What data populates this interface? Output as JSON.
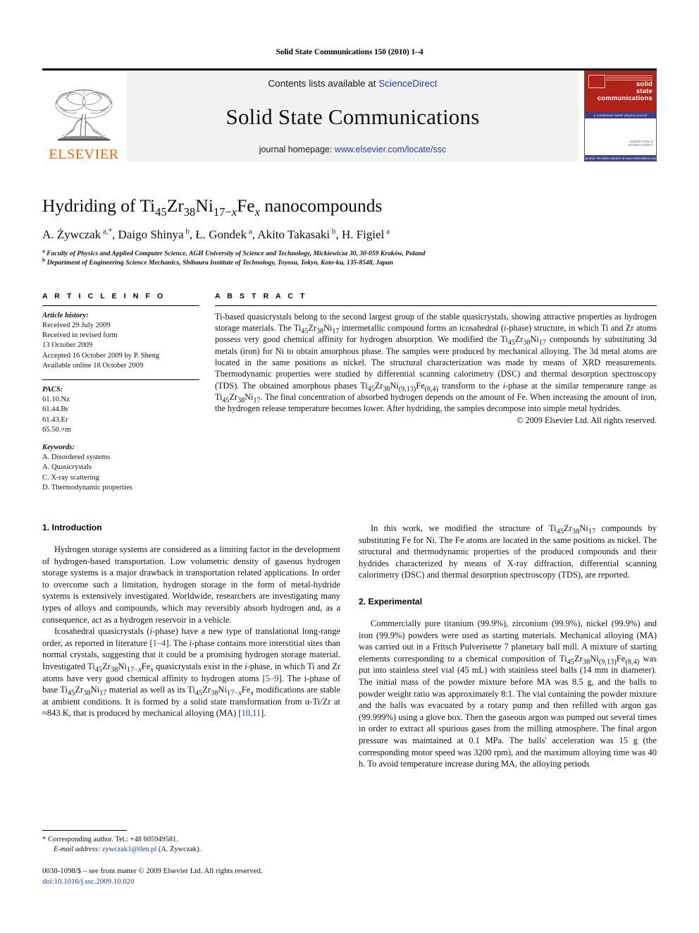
{
  "running_head": "Solid State Communications 150 (2010) 1–4",
  "journal_header": {
    "publisher_logo_text": "ELSEVIER",
    "contents_prefix": "Contents lists available at ",
    "contents_link": "ScienceDirect",
    "journal_title": "Solid State Communications",
    "homepage_prefix": "journal homepage: ",
    "homepage_url": "www.elsevier.com/locate/ssc",
    "cover": {
      "line1": "solid",
      "line2": "state",
      "line3": "communications",
      "strip_text": "a condensed matter physics journal",
      "footer_note_1": "available online at",
      "footer_note_2": "SCIENCE DIRECT",
      "bottom_strip": "Journal: The latest research at www.sciencedirect.com"
    },
    "link_color": "#2b3c9e",
    "band_color": "#f2f2f2",
    "elsevier_orange": "#ec6608",
    "cover_red": "#b02318"
  },
  "article": {
    "title_parts": [
      {
        "t": "Hydriding of Ti"
      },
      {
        "t": "45",
        "k": "sub"
      },
      {
        "t": "Zr"
      },
      {
        "t": "38",
        "k": "sub"
      },
      {
        "t": "Ni"
      },
      {
        "t": "17−x",
        "k": "sub-italic-x"
      },
      {
        "t": "Fe"
      },
      {
        "t": "x",
        "k": "sub-italic"
      },
      {
        "t": " nanocompounds"
      }
    ],
    "title_plain": "Hydriding of Ti45Zr38Ni17−xFex nanocompounds",
    "authors_plain": "A. Żywczak a,*, Daigo Shinya b, Ł. Gondek a, Akito Takasaki b, H. Figiel a",
    "affiliation_a": "Faculty of Physics and Applied Computer Science, AGH University of Science and Technology, Mickiewicza 30, 30-059 Kraków, Poland",
    "affiliation_b": "Department of Engineering Science Mechanics, Shibaura Institute of Technology, Toyosu, Tokyo, Koto-ku, 135-8548, Japan",
    "affiliation_a_marker": "a",
    "affiliation_b_marker": "b"
  },
  "article_info": {
    "heading": "A R T I C L E    I N F O",
    "history_label": "Article history:",
    "history_lines": [
      "Received 29 July 2009",
      "Received in revised form",
      "13 October 2009",
      "Accepted 16 October 2009 by P. Sheng",
      "Available online 18 October 2009"
    ],
    "pacs_label": "PACS:",
    "pacs": [
      "61.10.Nz",
      "61.44.Br",
      "61.43.Er",
      "65.50.+m"
    ],
    "keywords_label": "Keywords:",
    "keywords": [
      "A. Disordered systems",
      "A. Quasicrystals",
      "C. X-ray scattering",
      "D. Thermodynamic properties"
    ]
  },
  "abstract": {
    "heading": "A B S T R A C T",
    "text": "Ti-based quasicrystals belong to the second largest group of the stable quasicrystals, showing attractive properties as hydrogen storage materials. The Ti45Zr38Ni17 intermetallic compound forms an icosahedral (i-phase) structure, in which Ti and Zr atoms possess very good chemical affinity for hydrogen absorption. We modified the Ti45Zr38Ni17 compounds by substituting 3d metals (iron) for Ni to obtain amorphous phase. The samples were produced by mechanical alloying. The 3d metal atoms are located in the same positions as nickel. The structural characterization was made by means of XRD measurements. Thermodynamic properties were studied by differential scanning calorimetry (DSC) and thermal desorption spectroscopy (TDS). The obtained amorphous phases Ti45Zr38Ni(9,13)Fe(8,4) transform to the i-phase at the similar temperature range as Ti45Zr38Ni17. The final concentration of absorbed hydrogen depends on the amount of Fe. When increasing the amount of iron, the hydrogen release temperature becomes lower. After hydriding, the samples decompose into simple metal hydrides.",
    "copyright": "© 2009 Elsevier Ltd. All rights reserved."
  },
  "sections": {
    "intro_heading": "1. Introduction",
    "intro_p1": "Hydrogen storage systems are considered as a limiting factor in the development of hydrogen-based transportation. Low volumetric density of gaseous hydrogen storage systems is a major drawback in transportation related applications. In order to overcome such a limitation, hydrogen storage in the form of metal-hydride systems is extensively investigated. Worldwide, researchers are investigating many types of alloys and compounds, which may reversibly absorb hydrogen and, as a consequence, act as a hydrogen reservoir in a vehicle.",
    "intro_p2_plain": "Icosahedral quasicrystals (i-phase) have a new type of translational long-range order, as reported in literature [1–4]. The i-phase contains more interstitial sites than normal crystals, suggesting that it could be a promising hydrogen storage material. Investigated Ti45Zr38Ni17−xFex quasicrystals exist in the i-phase, in which Ti and Zr atoms have very good chemical affinity to hydrogen atoms [5–9]. The i-phase of base Ti45Zr38Ni17 material as well as its Ti45Zr38Ni17−xFex modifications are stable at ambient conditions. It is formed by a solid state transformation from α-Ti/Zr at ≈843 K, that is produced by mechanical alloying (MA) [10,11].",
    "right_p1_plain": "In this work, we modified the structure of Ti45Zr38Ni17 compounds by substituting Fe for Ni. The Fe atoms are located in the same positions as nickel. The structural and thermodynamic properties of the produced compounds and their hydrides characterized by means of X-ray diffraction, differential scanning calorimetry (DSC) and thermal desorption spectroscopy (TDS), are reported.",
    "experimental_heading": "2. Experimental",
    "exp_p1_plain": "Commercially pure titanium (99.9%), zirconium (99.9%), nickel (99.9%) and iron (99.9%) powders were used as starting materials. Mechanical alloying (MA) was carried out in a Fritsch Pulverisette 7 planetary ball mill. A mixture of starting elements corresponding to a chemical composition of Ti45Zr38Ni(9,13)Fe(8,4) was put into stainless steel vial (45 mL) with stainless steel balls (14 mm in diameter). The initial mass of the powder mixture before MA was 8.5 g, and the balls to powder weight ratio was approximately 8:1. The vial containing the powder mixture and the balls was evacuated by a rotary pump and then refilled with argon gas (99.999%) using a glove box. Then the gaseous argon was pumped out several times in order to extract all spurious gases from the milling atmosphere. The final argon pressure was maintained at 0.1 MPa. The balls' acceleration was 15 g (the corresponding motor speed was 3200 rpm), and the maximum alloying time was 40 h. To avoid temperature increase during MA, the alloying periods",
    "reference_color": "#1a3ea8"
  },
  "footnotes": {
    "corresponding_marker": "*",
    "corresponding_text": "Corresponding author. Tel.: +48 605949581.",
    "email_label": "E-mail address:",
    "email": "zywczak1@tlen.pl",
    "email_attribution": "(A. Żywczak).",
    "issn_line": "0038-1098/$ – see front matter © 2009 Elsevier Ltd. All rights reserved.",
    "doi_label": "doi:",
    "doi": "10.1016/j.ssc.2009.10.020"
  }
}
